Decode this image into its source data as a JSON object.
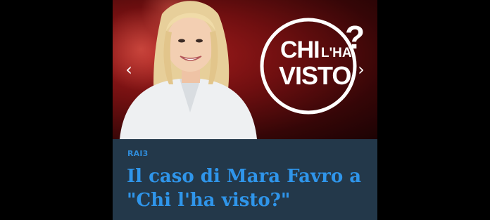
{
  "article": {
    "channel": "RAI3",
    "headline_line1": "Il caso di Mara Favro a",
    "headline_line2": "\"Chi l'ha visto?\""
  },
  "carousel": {
    "prev_icon": "chevron-left-icon",
    "next_icon": "chevron-right-icon",
    "prev_glyph": "‹",
    "next_glyph": "›"
  },
  "logo": {
    "chi": "CHI",
    "lha": "L'HA",
    "visto": "VISTO",
    "q": "?"
  },
  "colors": {
    "background": "#000000",
    "info_panel": "#23384a",
    "accent_blue": "#2f95ea",
    "hero_red": "#7a1212"
  }
}
